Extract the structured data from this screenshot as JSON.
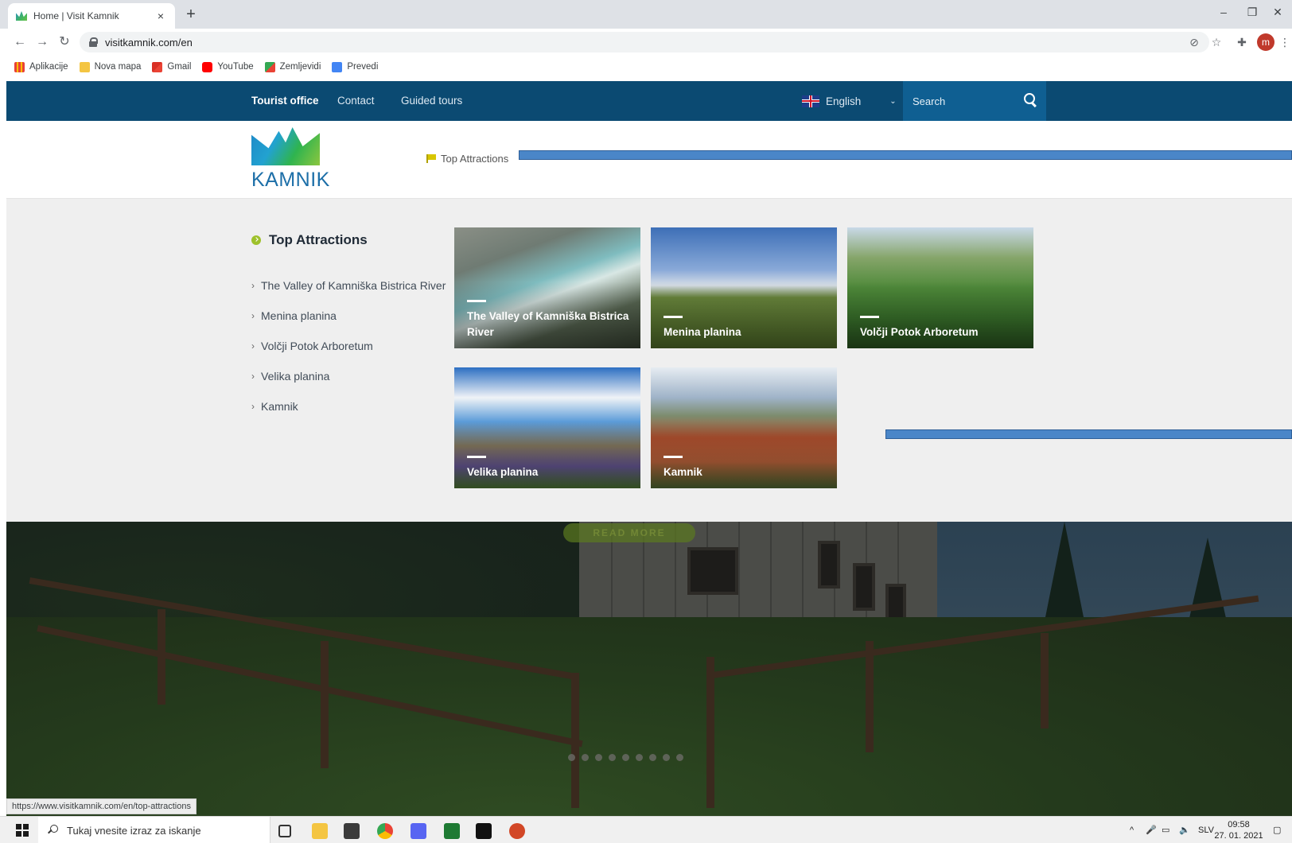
{
  "browser": {
    "tab_title": "Home | Visit Kamnik",
    "tab_close": "×",
    "new_tab": "+",
    "url": "visitkamnik.com/en",
    "window_controls": {
      "minimize": "–",
      "restore": "❐",
      "close": "✕"
    },
    "profile_initial": "m",
    "bookmarks": [
      {
        "label": "Aplikacije",
        "icon": "apps-grid-icon",
        "color": "#e94235"
      },
      {
        "label": "Nova mapa",
        "icon": "folder-icon",
        "color": "#f4c542"
      },
      {
        "label": "Gmail",
        "icon": "gmail-icon",
        "color": "#d93025"
      },
      {
        "label": "YouTube",
        "icon": "youtube-icon",
        "color": "#ff0000"
      },
      {
        "label": "Zemljevidi",
        "icon": "maps-icon",
        "color": "#34a853"
      },
      {
        "label": "Prevedi",
        "icon": "translate-icon",
        "color": "#4285f4"
      }
    ],
    "status_url": "https://www.visitkamnik.com/en/top-attractions"
  },
  "site": {
    "top_nav": [
      {
        "label": "Tourist office",
        "active": true
      },
      {
        "label": "Contact",
        "active": false
      },
      {
        "label": "Guided tours",
        "active": false
      }
    ],
    "language": "English",
    "search_placeholder": "Search",
    "logo_text": "KAMNIK",
    "breadcrumb": "Top Attractions",
    "dropdown": {
      "title": "Top Attractions",
      "links": [
        "The Valley of Kamniška Bistrica River",
        "Menina planina",
        "Volčji Potok Arboretum",
        "Velika planina",
        "Kamnik"
      ],
      "cards": [
        {
          "title": "The Valley of Kamniška Bistrica River"
        },
        {
          "title": "Menina planina"
        },
        {
          "title": "Volčji Potok Arboretum"
        },
        {
          "title": "Velika planina"
        },
        {
          "title": "Kamnik"
        }
      ]
    },
    "hero_button": "READ MORE"
  },
  "taskbar": {
    "search_placeholder": "Tukaj vnesite izraz za iskanje",
    "language": "SLV",
    "time": "09:58",
    "date": "27. 01. 2021"
  },
  "colors": {
    "nav_bg": "#0b4a72",
    "search_bg": "#0f5f92",
    "dropdown_bg": "#efefef",
    "accent_green": "#9ec12b",
    "annotation_bar": "#4a86c8"
  }
}
